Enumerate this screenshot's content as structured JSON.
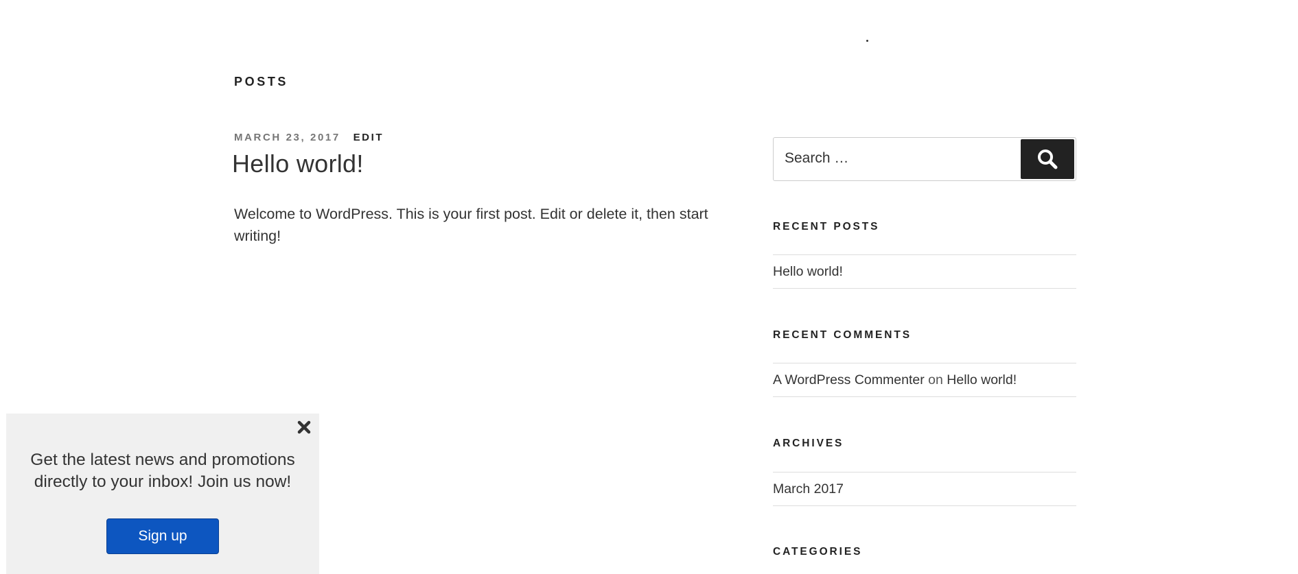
{
  "main": {
    "section_heading": "POSTS",
    "post": {
      "date": "MARCH 23, 2017",
      "edit_label": "EDIT",
      "title": "Hello world!",
      "content": "Welcome to WordPress. This is your first post. Edit or delete it, then start writing!"
    }
  },
  "sidebar": {
    "search": {
      "placeholder": "Search …",
      "button_icon": "search-icon"
    },
    "recent_posts": {
      "title": "RECENT POSTS",
      "items": [
        "Hello world!"
      ]
    },
    "recent_comments": {
      "title": "RECENT COMMENTS",
      "author": "A WordPress Commenter",
      "connector": "on",
      "post": "Hello world!"
    },
    "archives": {
      "title": "ARCHIVES",
      "items": [
        "March 2017"
      ]
    },
    "categories": {
      "title": "CATEGORIES"
    }
  },
  "popup": {
    "close_icon": "close-icon",
    "message": "Get the latest news and promotions directly to your inbox! Join us now!",
    "signup_label": "Sign up"
  },
  "colors": {
    "signup_button": "#0d56c0",
    "search_button": "#222222",
    "popup_background": "#f0f0f0"
  }
}
